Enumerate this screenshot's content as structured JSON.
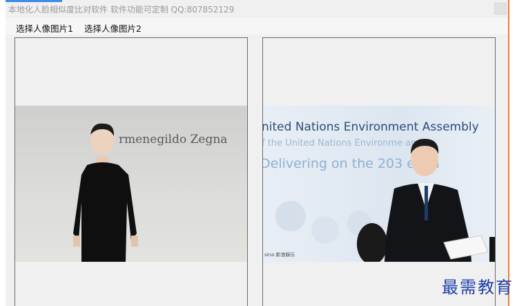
{
  "window": {
    "title": "本地化人脸相似度比对软件 软件功能可定制   QQ:807852129"
  },
  "menu": {
    "items": [
      {
        "label": "选择人像图片1"
      },
      {
        "label": "选择人像图片2"
      }
    ]
  },
  "photo1": {
    "backdrop_text": "rmenegildo Zegna"
  },
  "photo2": {
    "line1": "nited Nations Environment Assembly",
    "line2": "f the United Nations Environme      amme",
    "line3": "Delivering on the 203        enda",
    "credit": "sina 新浪娱乐"
  },
  "watermark": {
    "text": "最需教育"
  },
  "colors": {
    "accent_blue": "#3c8ce7",
    "edge_orange": "#f07a3a",
    "watermark_blue": "#1d3fa8"
  }
}
